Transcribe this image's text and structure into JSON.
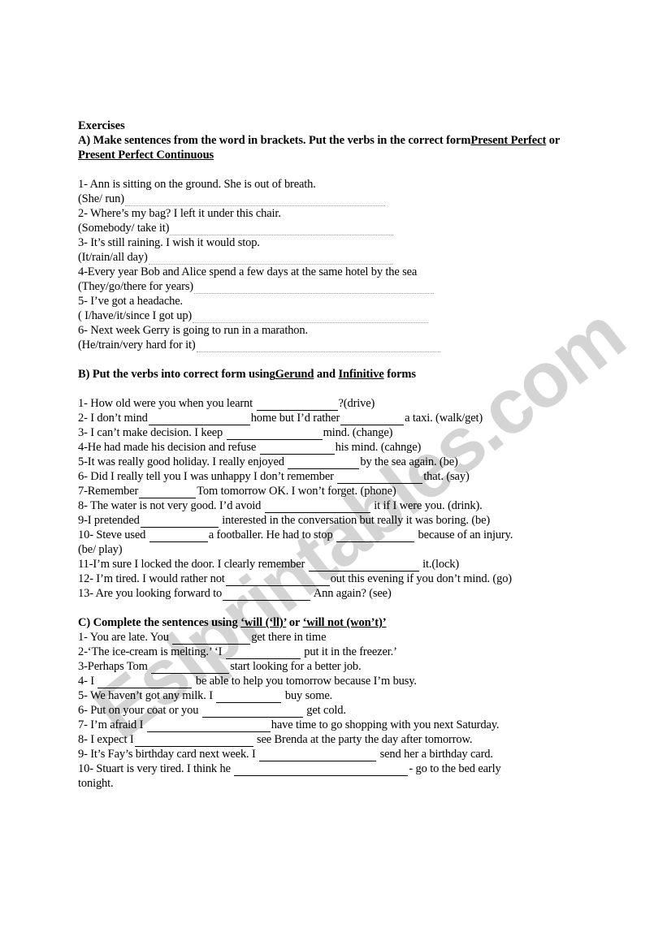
{
  "document": {
    "title": "Exercises",
    "watermark": "Eslprintables.com",
    "watermark_color": "#d4d4d4",
    "page_background": "#ffffff",
    "text_color": "#000000"
  },
  "sections": [
    {
      "id": "section-a",
      "heading_parts": [
        {
          "text": "A) Make sentences from the word in brackets. Put the verbs in the correct form",
          "underline": false
        },
        {
          "text": "Present Perfect",
          "underline": true
        },
        {
          "text": " or ",
          "underline": false
        },
        {
          "text": "Present Perfect Continuous",
          "underline": true
        }
      ],
      "style": "dotted",
      "items": [
        {
          "prompt": "1- Ann is sitting on the ground. She is out of breath.",
          "answer_line": "(She/ run)",
          "leader_width": 320
        },
        {
          "prompt": "2- Where’s my bag? I left it under this chair.",
          "answer_line": "(Somebody/ take it)",
          "leader_width": 275
        },
        {
          "prompt": "3- It’s still raining. I wish it would stop.",
          "answer_line": "(It/rain/all day)",
          "leader_width": 300
        },
        {
          "prompt": "4-Every year Bob and Alice spend a few days at the same hotel by the sea",
          "answer_line": "(They/go/there for years)",
          "leader_width": 295
        },
        {
          "prompt": "5- I’ve got a headache.",
          "answer_line": "( I/have/it/since I got up)",
          "leader_width": 290
        },
        {
          "prompt": "6- Next week Gerry is going to run in a marathon.",
          "answer_line": "(He/train/very hard for it)",
          "leader_width": 300
        }
      ]
    },
    {
      "id": "section-b",
      "heading_parts": [
        {
          "text": "B) Put the verbs into correct form using",
          "underline": false
        },
        {
          "text": "Gerund",
          "underline": true
        },
        {
          "text": " and ",
          "underline": false
        },
        {
          "text": "Infinitive",
          "underline": true
        },
        {
          "text": " forms",
          "underline": false
        }
      ],
      "style": "blank",
      "items": [
        {
          "segments": [
            {
              "t": "1- How old were you when you learnt "
            },
            {
              "blank": 100
            },
            {
              "t": "?(drive)"
            }
          ]
        },
        {
          "segments": [
            {
              "t": "2- I don’t mind"
            },
            {
              "blank": 125
            },
            {
              "t": "home but I’d rather"
            },
            {
              "blank": 78
            },
            {
              "t": "a taxi. (walk/get)"
            }
          ]
        },
        {
          "segments": [
            {
              "t": "3- I can’t make decision. I keep "
            },
            {
              "blank": 118
            },
            {
              "t": "mind. (change)"
            }
          ]
        },
        {
          "segments": [
            {
              "t": "4-He had made his decision and refuse "
            },
            {
              "blank": 92
            },
            {
              "t": "his mind. (cahnge)"
            }
          ]
        },
        {
          "segments": [
            {
              "t": "5-It was really good holiday. I really enjoyed "
            },
            {
              "blank": 88
            },
            {
              "t": "by the sea again. (be)"
            }
          ]
        },
        {
          "segments": [
            {
              "t": "6- Did I really tell you I was unhappy I don’t remember "
            },
            {
              "blank": 105
            },
            {
              "t": "that. (say)"
            }
          ]
        },
        {
          "segments": [
            {
              "t": "7-Remember"
            },
            {
              "blank": 70
            },
            {
              "t": "Tom tomorrow OK. I won’t forget. (phone)"
            }
          ]
        },
        {
          "segments": [
            {
              "t": "8- The water is not very good. I’d avoid "
            },
            {
              "blank": 130
            },
            {
              "t": " it if I were you. (drink)."
            }
          ]
        },
        {
          "segments": [
            {
              "t": "9-I pretended"
            },
            {
              "blank": 96
            },
            {
              "t": " interested in the conversation but really it was boring. (be)"
            }
          ]
        },
        {
          "segments": [
            {
              "t": "10- Steve used "
            },
            {
              "blank": 72
            },
            {
              "t": "a footballer. He had to stop "
            },
            {
              "blank": 96
            },
            {
              "t": " because of an injury."
            }
          ]
        },
        {
          "segments": [
            {
              "t": "(be/ play)"
            }
          ]
        },
        {
          "segments": [
            {
              "t": "11-I’m sure I locked the door. I clearly remember "
            },
            {
              "blank": 136
            },
            {
              "t": " it.(lock)"
            }
          ]
        },
        {
          "segments": [
            {
              "t": "12- I’m tired. I would rather not"
            },
            {
              "blank": 128
            },
            {
              "t": "out this evening if you don’t mind. (go)"
            }
          ]
        },
        {
          "segments": [
            {
              "t": "13- Are you looking forward to"
            },
            {
              "blank": 108
            },
            {
              "t": " Ann again? (see)"
            }
          ]
        }
      ]
    },
    {
      "id": "section-c",
      "heading_parts": [
        {
          "text": "C) Complete the sentences using ",
          "underline": false
        },
        {
          "text": "‘will (‘ll)’",
          "underline": true
        },
        {
          "text": " or ",
          "underline": false
        },
        {
          "text": "‘will not (won’t)’",
          "underline": true
        }
      ],
      "style": "blank",
      "items": [
        {
          "segments": [
            {
              "t": "1- You are late. You "
            },
            {
              "blank": 96
            },
            {
              "t": "get there in time"
            }
          ]
        },
        {
          "segments": [
            {
              "t": "2-‘The ice-cream is melting.’ ‘I "
            },
            {
              "blank": 92
            },
            {
              "t": " put it in the freezer.’"
            }
          ]
        },
        {
          "segments": [
            {
              "t": "3-Perhaps Tom "
            },
            {
              "blank": 96
            },
            {
              "t": "start looking for a better job."
            }
          ]
        },
        {
          "segments": [
            {
              "t": "4- I "
            },
            {
              "blank": 116
            },
            {
              "t": " be able to help you tomorrow because I’m busy."
            }
          ]
        },
        {
          "segments": [
            {
              "t": "5- We haven’t got any milk. I "
            },
            {
              "blank": 80
            },
            {
              "t": " buy some."
            }
          ]
        },
        {
          "segments": [
            {
              "t": "6- Put on your coat or you "
            },
            {
              "blank": 124
            },
            {
              "t": " get cold."
            }
          ]
        },
        {
          "segments": [
            {
              "t": "7- I’m afraid I "
            },
            {
              "blank": 152
            },
            {
              "t": "have time to go shopping with you next Saturday."
            }
          ]
        },
        {
          "segments": [
            {
              "t": "8- I expect I"
            },
            {
              "blank": 146
            },
            {
              "t": " see Brenda at the party the day after tomorrow."
            }
          ]
        },
        {
          "segments": [
            {
              "t": "9- It’s Fay’s birthday card next week. I "
            },
            {
              "blank": 144
            },
            {
              "t": " send her a birthday card."
            }
          ]
        },
        {
          "segments": [
            {
              "t": "10- Stuart is very tired. I think he "
            },
            {
              "blank": 214
            },
            {
              "t": "- go to the bed early"
            }
          ]
        },
        {
          "segments": [
            {
              "t": "tonight."
            }
          ]
        }
      ]
    }
  ]
}
